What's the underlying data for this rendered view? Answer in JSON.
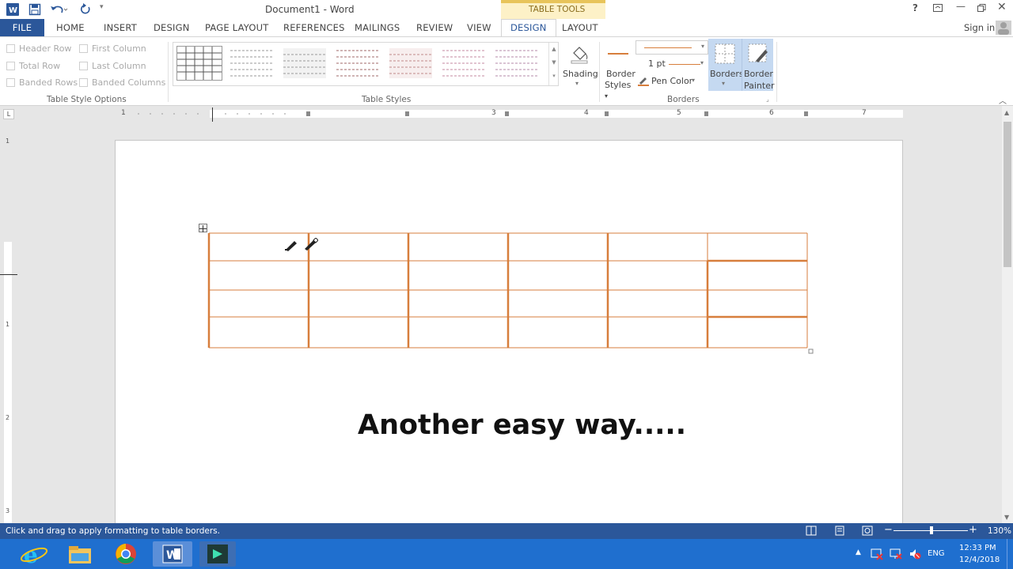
{
  "window": {
    "title": "Document1 - Word",
    "sign_in": "Sign in"
  },
  "quick_access": {
    "help": "?"
  },
  "contextual": {
    "table_tools": "TABLE TOOLS"
  },
  "tabs": [
    {
      "label": "FILE"
    },
    {
      "label": "HOME"
    },
    {
      "label": "INSERT"
    },
    {
      "label": "DESIGN"
    },
    {
      "label": "PAGE LAYOUT"
    },
    {
      "label": "REFERENCES"
    },
    {
      "label": "MAILINGS"
    },
    {
      "label": "REVIEW"
    },
    {
      "label": "VIEW"
    },
    {
      "label": "DESIGN"
    },
    {
      "label": "LAYOUT"
    }
  ],
  "table_style_options": {
    "header_row": "Header Row",
    "total_row": "Total Row",
    "banded_rows": "Banded Rows",
    "first_column": "First Column",
    "last_column": "Last Column",
    "banded_columns": "Banded Columns",
    "group_label": "Table Style Options"
  },
  "table_styles": {
    "group_label": "Table Styles",
    "shading": "Shading"
  },
  "borders": {
    "border_styles_1": "Border",
    "border_styles_2": "Styles",
    "weight": "1 pt",
    "pen_color": "Pen Color",
    "borders_btn": "Borders",
    "border_painter_1": "Border",
    "border_painter_2": "Painter",
    "group_label": "Borders",
    "accent": "#d77e3c"
  },
  "ruler": {
    "tab_marker": "L",
    "numbers": [
      "1",
      "1",
      "2",
      "3",
      "4",
      "5",
      "6",
      "7"
    ],
    "vnumbers": [
      "1",
      "1",
      "2",
      "3"
    ]
  },
  "document": {
    "heading": "Another easy way....."
  },
  "status": {
    "message": "Click and drag to apply formatting to table borders.",
    "zoom": "130%"
  },
  "tray": {
    "lang": "ENG",
    "time": "12:33 PM",
    "date": "12/4/2018"
  },
  "colors": {
    "brand": "#2b579a",
    "accent_orange": "#d77e3c",
    "table_tools_bg": "#fdf1c7"
  }
}
